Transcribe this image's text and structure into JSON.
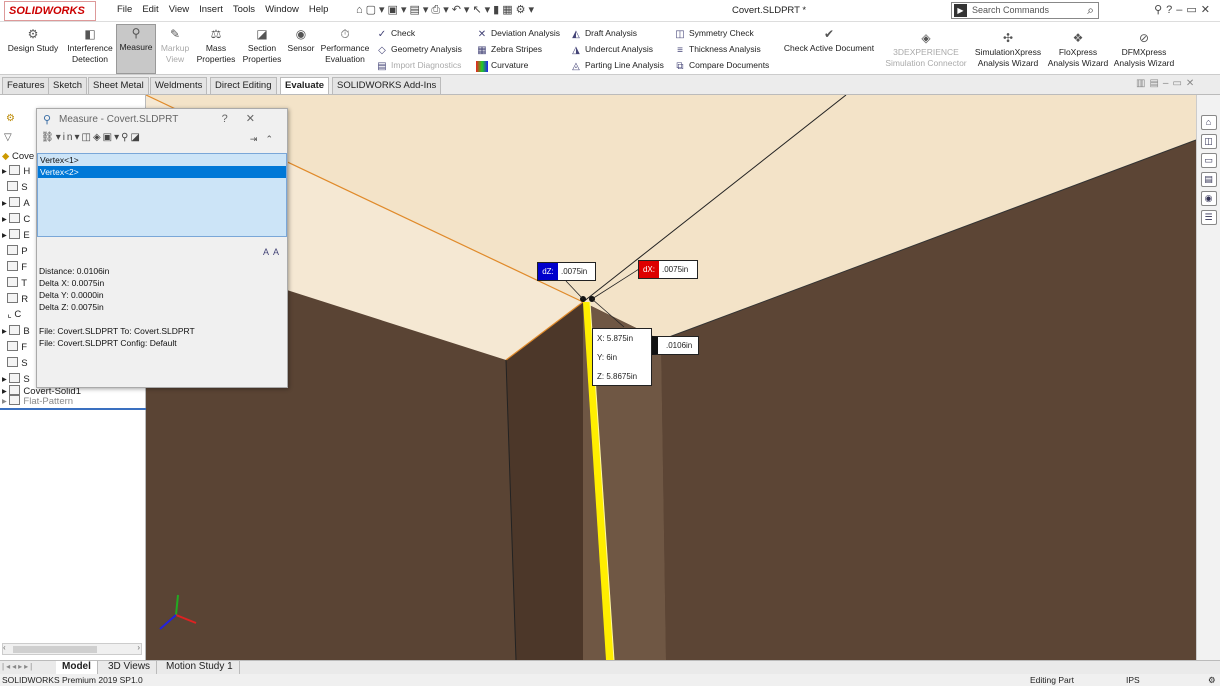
{
  "titlebar": {
    "brand": "SOLIDWORKS",
    "menu": [
      "File",
      "Edit",
      "View",
      "Insert",
      "Tools",
      "Window",
      "Help"
    ],
    "document_title": "Covert.SLDPRT *",
    "search_placeholder": "Search Commands"
  },
  "ribbon": {
    "large": [
      {
        "label": "Design Study",
        "icon": "design-study-icon"
      },
      {
        "label": "Interference Detection",
        "icon": "interference-icon"
      },
      {
        "label": "Measure",
        "icon": "measure-icon",
        "active": true
      },
      {
        "label": "Markup View",
        "icon": "markup-icon",
        "disabled": true
      },
      {
        "label": "Mass Properties",
        "icon": "mass-properties-icon"
      },
      {
        "label": "Section Properties",
        "icon": "section-properties-icon"
      },
      {
        "label": "Sensor",
        "icon": "sensor-icon"
      },
      {
        "label": "Performance Evaluation",
        "icon": "performance-icon"
      },
      {
        "label": "Check Active Document",
        "icon": "check-active-icon"
      },
      {
        "label": "3DEXPERIENCE Simulation Connector",
        "icon": "3dexperience-icon",
        "disabled": true
      },
      {
        "label": "SimulationXpress Analysis Wizard",
        "icon": "simulationxpress-icon"
      },
      {
        "label": "FloXpress Analysis Wizard",
        "icon": "floxpress-icon"
      },
      {
        "label": "DFMXpress Analysis Wizard",
        "icon": "dfmxpress-icon"
      }
    ],
    "small": [
      {
        "label": "Check",
        "icon": "check-icon"
      },
      {
        "label": "Geometry Analysis",
        "icon": "geometry-analysis-icon"
      },
      {
        "label": "Import Diagnostics",
        "icon": "import-diagnostics-icon",
        "disabled": true
      },
      {
        "label": "Deviation Analysis",
        "icon": "deviation-analysis-icon"
      },
      {
        "label": "Zebra Stripes",
        "icon": "zebra-stripes-icon"
      },
      {
        "label": "Curvature",
        "icon": "curvature-icon"
      },
      {
        "label": "Draft Analysis",
        "icon": "draft-analysis-icon"
      },
      {
        "label": "Undercut Analysis",
        "icon": "undercut-analysis-icon"
      },
      {
        "label": "Parting Line Analysis",
        "icon": "parting-line-icon"
      },
      {
        "label": "Symmetry Check",
        "icon": "symmetry-check-icon"
      },
      {
        "label": "Thickness Analysis",
        "icon": "thickness-analysis-icon"
      },
      {
        "label": "Compare Documents",
        "icon": "compare-documents-icon"
      }
    ]
  },
  "tabs": [
    "Features",
    "Sketch",
    "Sheet Metal",
    "Weldments",
    "Direct Editing",
    "Evaluate",
    "SOLIDWORKS Add-Ins"
  ],
  "active_tab": "Evaluate",
  "tree": {
    "root": "Cove",
    "items": [
      "H",
      "S",
      "A",
      "C",
      "E",
      "P",
      "F",
      "T",
      "R",
      "C",
      "B",
      "F",
      "S",
      "S",
      "Covert-Solid1",
      "Flat-Pattern"
    ]
  },
  "measure": {
    "title": "Measure - Covert.SLDPRT",
    "selections": [
      "Vertex<1>",
      "Vertex<2>"
    ],
    "results": [
      "Distance: 0.0106in",
      "Delta X: 0.0075in",
      "Delta Y: 0.0000in",
      "Delta Z: 0.0075in",
      "",
      "File: Covert.SLDPRT To: Covert.SLDPRT",
      "File: Covert.SLDPRT Config: Default"
    ]
  },
  "callouts": {
    "dz": {
      "tag": "dZ:",
      "value": ".0075in",
      "color": "#0000cc"
    },
    "dx": {
      "tag": "dX:",
      "value": ".0075in",
      "color": "#dd0000"
    },
    "dist": {
      "value": ".0106in"
    },
    "coords": {
      "x": "5.875in",
      "y": "6in",
      "z": "5.8675in"
    }
  },
  "bottom_tabs": [
    "Model",
    "3D Views",
    "Motion Study 1"
  ],
  "status": {
    "left": "SOLIDWORKS Premium 2019 SP1.0",
    "mode": "Editing Part",
    "units": "IPS"
  },
  "colors": {
    "accent": "#0078d7",
    "surface_top": "#f3e3c8",
    "surface_side": "#5a4434",
    "edge_highlight": "#ffee00"
  }
}
